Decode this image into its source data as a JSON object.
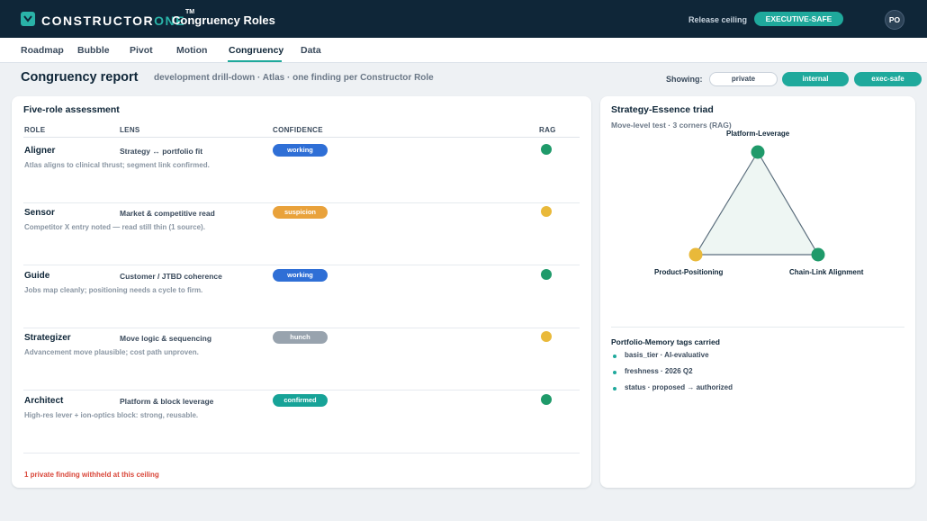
{
  "header": {
    "brand_main": "CONSTRUCTOR",
    "brand_accent": "ONE",
    "brand_tm": "TM",
    "app_title": "Congruency Roles",
    "release_ceiling_label": "Release ceiling",
    "release_ceiling_value": "EXECUTIVE-SAFE",
    "user_initials": "PO"
  },
  "nav": {
    "tabs": [
      {
        "label": "Roadmap"
      },
      {
        "label": "Bubble"
      },
      {
        "label": "Pivot"
      },
      {
        "label": "Motion"
      },
      {
        "label": "Congruency"
      },
      {
        "label": "Data"
      }
    ],
    "active_tab": "Congruency"
  },
  "page": {
    "title": "Congruency report",
    "subtitle": "development drill-down · Atlas · one finding per Constructor Role",
    "showing_label": "Showing:",
    "visibility": [
      {
        "label": "private",
        "selected": false
      },
      {
        "label": "internal",
        "selected": true
      },
      {
        "label": "exec-safe",
        "selected": true
      }
    ]
  },
  "assessment": {
    "title": "Five-role assessment",
    "columns": {
      "role": "ROLE",
      "lens": "LENS",
      "confidence": "CONFIDENCE",
      "rag": "RAG"
    },
    "rows": [
      {
        "role": "Aligner",
        "lens": "Strategy ↔ portfolio fit",
        "note": "Atlas aligns to clinical thrust; segment link confirmed.",
        "confidence": "working",
        "rag": "green"
      },
      {
        "role": "Sensor",
        "lens": "Market & competitive read",
        "note": "Competitor X entry noted — read still thin (1 source).",
        "confidence": "suspicion",
        "rag": "amber"
      },
      {
        "role": "Guide",
        "lens": "Customer / JTBD coherence",
        "note": "Jobs map cleanly; positioning needs a cycle to firm.",
        "confidence": "working",
        "rag": "green"
      },
      {
        "role": "Strategizer",
        "lens": "Move logic & sequencing",
        "note": "Advancement move plausible; cost path unproven.",
        "confidence": "hunch",
        "rag": "amber"
      },
      {
        "role": "Architect",
        "lens": "Platform & block leverage",
        "note": "High-res lever + ion-optics block: strong, reusable.",
        "confidence": "confirmed",
        "rag": "green"
      }
    ],
    "withheld_note": "1 private finding withheld at this ceiling"
  },
  "triad": {
    "title": "Strategy-Essence triad",
    "subtitle": "Move-level test · 3 corners (RAG)",
    "corners": [
      {
        "label": "Platform-Leverage",
        "rag": "green"
      },
      {
        "label": "Product-Positioning",
        "rag": "amber"
      },
      {
        "label": "Chain-Link Alignment",
        "rag": "green"
      }
    ]
  },
  "memory": {
    "title": "Portfolio-Memory tags carried",
    "tags": [
      {
        "text": "basis_tier · AI-evaluative"
      },
      {
        "text": "freshness · 2026 Q2"
      },
      {
        "text": "status · proposed → authorized"
      }
    ]
  },
  "colors": {
    "header_bg": "#0f2638",
    "accent_teal": "#1fa99c",
    "rag_green": "#1f9a6a",
    "rag_amber": "#e9b93a",
    "conf_working": "#2f6fd6",
    "conf_suspicion": "#e9a23b",
    "conf_hunch": "#98a3ae",
    "conf_confirmed": "#17a398",
    "warning_red": "#d9473a"
  }
}
